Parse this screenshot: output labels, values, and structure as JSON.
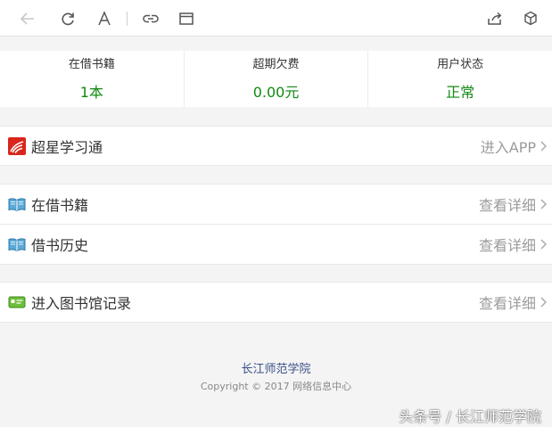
{
  "toolbar": {
    "icons": [
      "back-arrow-icon",
      "refresh-icon",
      "font-size-icon",
      "link-icon",
      "window-icon",
      "share-icon",
      "cube-icon"
    ]
  },
  "stats": [
    {
      "label": "在借书籍",
      "value": "1本"
    },
    {
      "label": "超期欠费",
      "value": "0.00元"
    },
    {
      "label": "用户状态",
      "value": "正常"
    }
  ],
  "rows": {
    "chaoxing": {
      "label": "超星学习通",
      "action": "进入APP"
    },
    "borrowed": {
      "label": "在借书籍",
      "action": "查看详细"
    },
    "history": {
      "label": "借书历史",
      "action": "查看详细"
    },
    "entry": {
      "label": "进入图书馆记录",
      "action": "查看详细"
    }
  },
  "footer": {
    "school": "长江师范学院",
    "copyright": "Copyright © 2017 网络信息中心"
  },
  "watermark": "头条号 / 长江师范学院",
  "colors": {
    "accent_green": "#118a11",
    "footer_link": "#3a4f88",
    "muted": "#9b9b9b"
  }
}
